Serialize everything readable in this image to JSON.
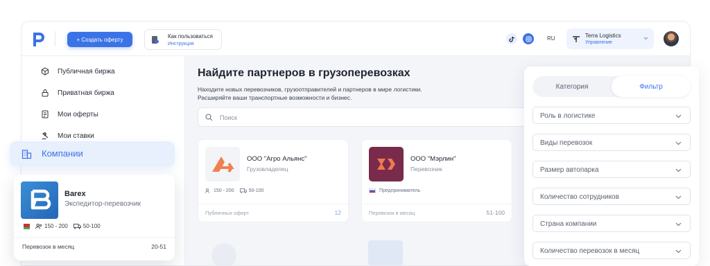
{
  "header": {
    "create_label": "+ Создать оферту",
    "howto_title": "Как пользоваться",
    "howto_sub": "Инструкция",
    "lang": "RU",
    "account_name": "Terra Logistics",
    "account_role": "Управление"
  },
  "sidebar": {
    "items": [
      {
        "label": "Публичная биржа",
        "icon": "cube-icon"
      },
      {
        "label": "Приватная биржа",
        "icon": "lock-icon"
      },
      {
        "label": "Мои оферты",
        "icon": "document-icon"
      },
      {
        "label": "Мои ставки",
        "icon": "gavel-icon"
      }
    ],
    "active_label": "Компании"
  },
  "main": {
    "title": "Найдите партнеров в грузоперевозках",
    "subtitle_line1": "Находите новых перевозчиков, грузоотправителей и партнеров в мире логистики.",
    "subtitle_line2": "Расширяйте ваши транспортные возможности и бизнес.",
    "search_placeholder": "Поиск",
    "cards": [
      {
        "name": "ООО \"Агро Альянс\"",
        "role": "Грузовладелец",
        "fleet": "150 - 200",
        "trucks": "50-100",
        "footer_label": "Публичных оферт",
        "footer_value": "12"
      },
      {
        "name": "ООО \"Мэрлин\"",
        "role": "Перевозчик",
        "badge": "Предприниматель",
        "footer_label": "Перевозок в месяц",
        "footer_value": "51-100"
      }
    ]
  },
  "filter": {
    "tab_category": "Категория",
    "tab_filter": "Фильтр",
    "selects": [
      "Роль в логистике",
      "Виды перевозок",
      "Размер автопарка",
      "Количество сотрудников",
      "Страна компании",
      "Количество перевозок в месяц"
    ]
  },
  "barex": {
    "name": "Barex",
    "role": "Экспедитор-перевозчик",
    "fleet": "150 - 200",
    "trucks": "50-100",
    "footer_label": "Перевозок в месяц",
    "footer_value": "20-51"
  },
  "colors": {
    "accent": "#3b73e6",
    "active_bg": "#e8effd"
  }
}
